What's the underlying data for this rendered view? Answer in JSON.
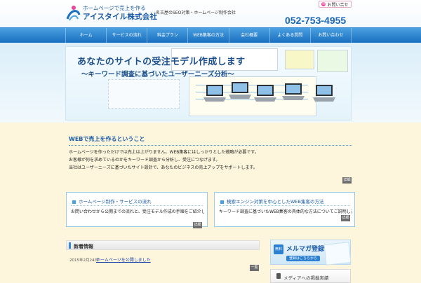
{
  "header": {
    "tagline": "ホームページで売上を作る",
    "company": "アイスタイル株式会社",
    "description": "名古屋のSEO対策・ホームページ制作会社",
    "contact_label": "お問い合せ",
    "phone": "052-753-4955"
  },
  "nav": {
    "items": [
      "ホーム",
      "サービスの流れ",
      "料金プラン",
      "WEB集客の方法",
      "会社概要",
      "よくある質問",
      "お問い合わせ"
    ]
  },
  "hero": {
    "title": "あなたのサイトの受注モデル作成します",
    "subtitle": "〜キーワード調査に基づいたユーザーニーズ分析〜"
  },
  "intro": {
    "title": "WEBで売上を作るということ",
    "lines": [
      "ホームページを作っただけでは売上は上がりません。WEB集客にはしっかりとした戦略が必要です。",
      "お客様が何を求めているのかをキーワード調査から分析し、受注につなげます。",
      "当社はユーザーニーズに基づいたサイト設計で、あなたのビジネスの売上アップをサポートします。"
    ],
    "more_label": "詳細"
  },
  "boxes": [
    {
      "title": "ホームページ制作・サービスの流れ",
      "text": "お問い合わせから公開までの流れと、受注モデル作成の手順をご紹介します。",
      "more_label": "詳細"
    },
    {
      "title": "検索エンジン対策を中心としたWEB集客の方法",
      "text": "キーワード調査に基づいたWEB集客の具体的な方法についてご説明します。",
      "more_label": "詳細"
    }
  ],
  "news": {
    "title": "新着情報",
    "items": [
      {
        "date": "2015年2月24日",
        "title": "ホームページを公開しました"
      }
    ],
    "more_label": "一覧"
  },
  "sidebar": {
    "mail_badge": "無料",
    "mail_title": "メルマガ登録",
    "mail_button": "登録はこちらから",
    "media_title": "メディアへの掲載実績"
  },
  "colors": {
    "brand": "#1a5aa6",
    "nav": "#1a6fc0",
    "accent_pink": "#e8469a"
  }
}
